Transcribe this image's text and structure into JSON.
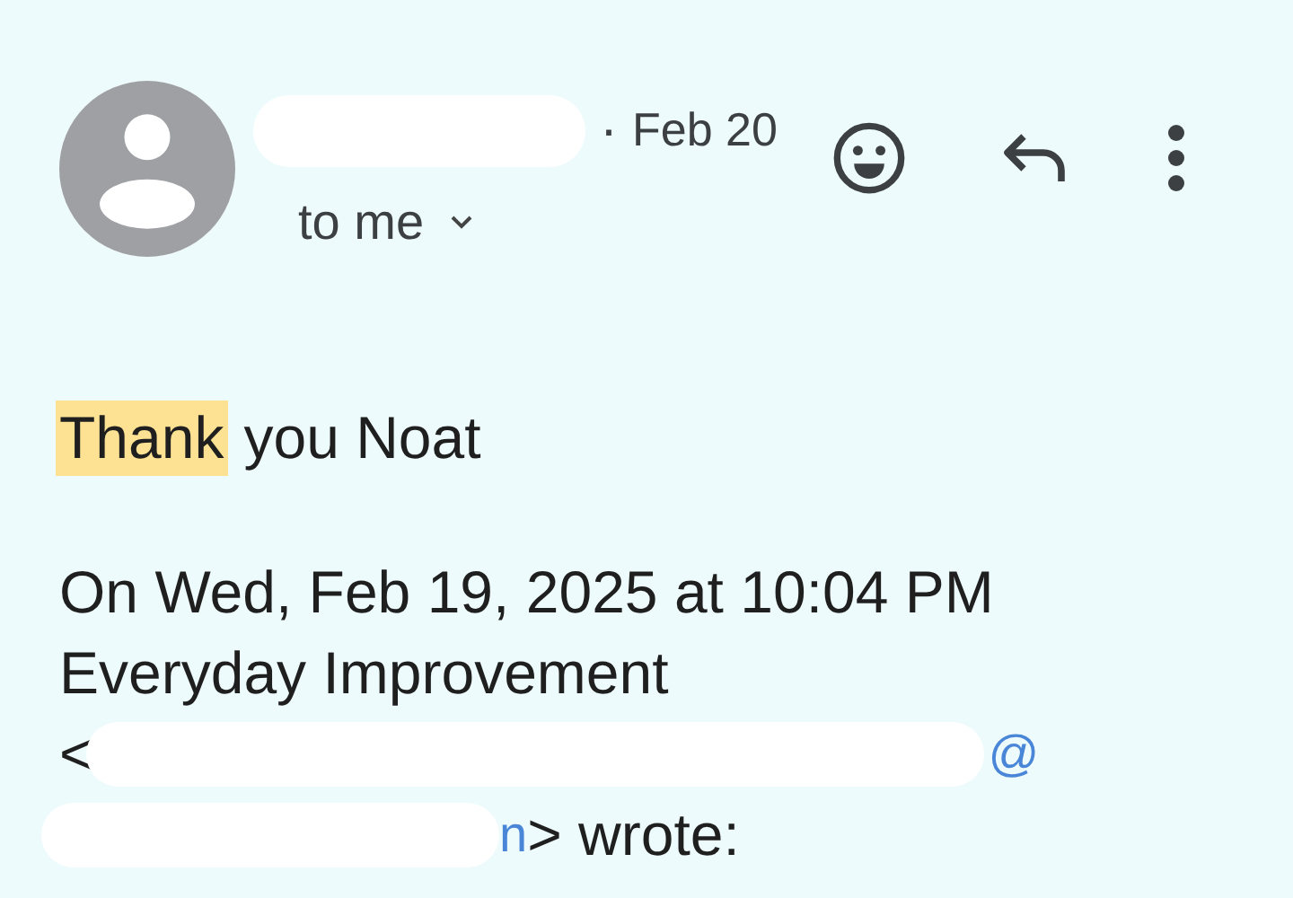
{
  "header": {
    "separator": "·",
    "date": "Feb 20",
    "recipient": "to me"
  },
  "body": {
    "greeting": [
      {
        "text": "Thank",
        "highlighted": true
      },
      {
        "text": "you Noat",
        "highlighted": false
      }
    ],
    "quote_intro": "On Wed, Feb 19, 2025 at 10:04 PM",
    "sender_name": "Everyday Improvement",
    "email_open": "<",
    "email_at": "@",
    "email_end": "n",
    "wrote": "> wrote:"
  }
}
